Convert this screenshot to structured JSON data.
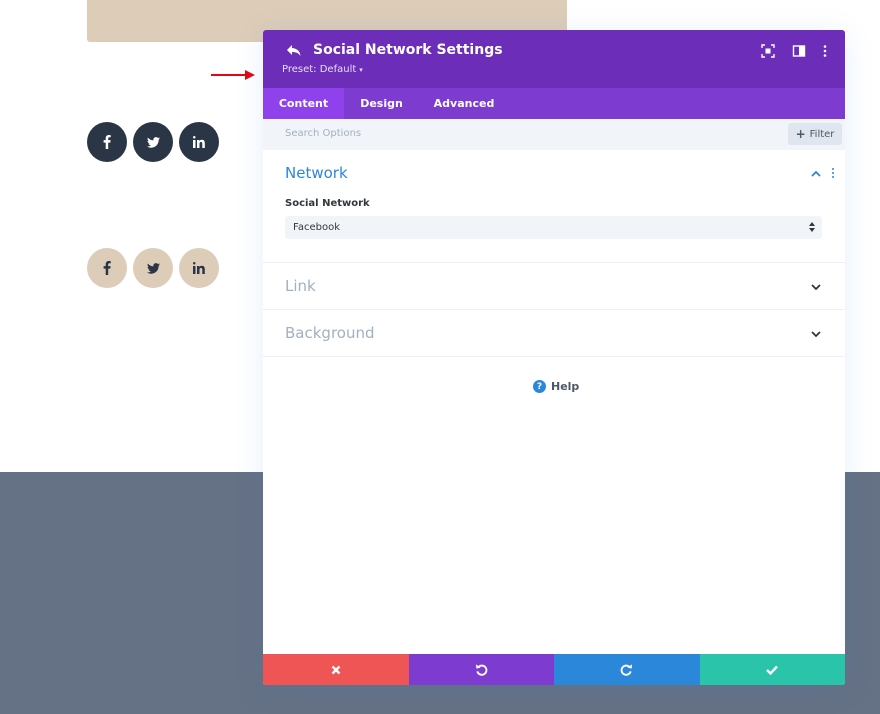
{
  "panel": {
    "title": "Social Network Settings",
    "preset_label": "Preset: Default",
    "preset_caret": "▾",
    "header_icons": [
      "back-icon",
      "fullscreen-icon",
      "split-view-icon",
      "more-vertical-icon"
    ]
  },
  "tabs": [
    {
      "label": "Content",
      "active": true
    },
    {
      "label": "Design",
      "active": false
    },
    {
      "label": "Advanced",
      "active": false
    }
  ],
  "search": {
    "placeholder": "Search Options",
    "filter_label": "Filter",
    "filter_icon": "+"
  },
  "sections": {
    "network": {
      "title": "Network",
      "field_label": "Social Network",
      "select_value": "Facebook",
      "expanded": true
    },
    "link": {
      "title": "Link",
      "expanded": false
    },
    "background": {
      "title": "Background",
      "expanded": false
    }
  },
  "help": {
    "label": "Help",
    "icon": "?"
  },
  "social_icons": {
    "dark_row": [
      "f",
      "twitter",
      "in"
    ],
    "tan_row": [
      "f",
      "twitter",
      "in"
    ]
  },
  "footer_actions": [
    "cancel-icon",
    "undo-icon",
    "redo-icon",
    "check-icon"
  ],
  "colors": {
    "header_purple": "#6c2eb9",
    "tab_purple": "#7d3bcf",
    "active_tab": "#8f42ec",
    "section_blue": "#2b87da",
    "cancel_red": "#ef5555",
    "undo_purple": "#7e3bd0",
    "redo_blue": "#2b87da",
    "save_green": "#29c4a9",
    "dark_social": "#2a3545",
    "tan_social": "#ddccb8",
    "footer_band": "#657184",
    "arrow_red": "#e30613"
  }
}
